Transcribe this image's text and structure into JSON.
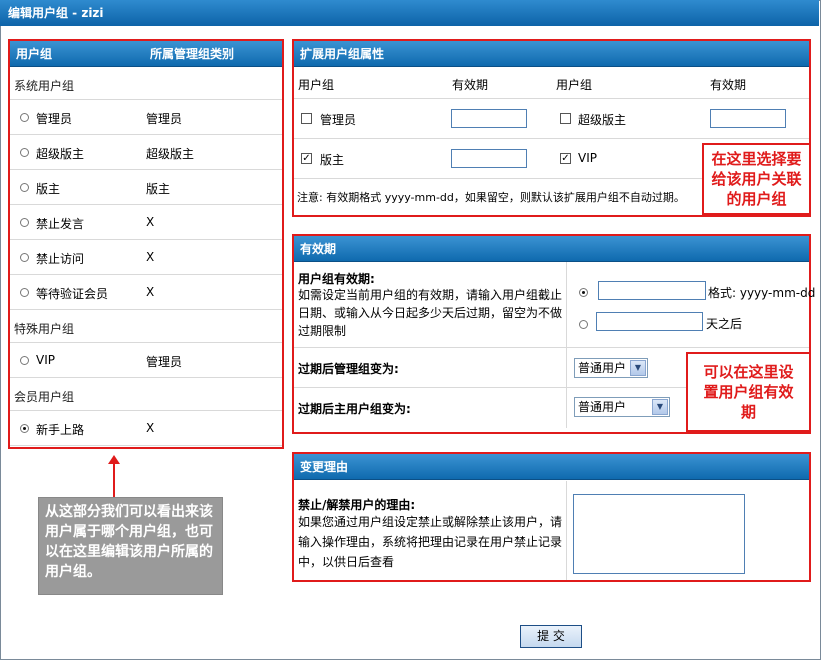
{
  "window": {
    "title": "编辑用户组 - zizi"
  },
  "left_panel": {
    "col_group": "用户组",
    "col_admin": "所属管理组类别",
    "sections": [
      {
        "title": "系统用户组",
        "items": [
          {
            "name": "管理员",
            "admin": "管理员",
            "selected": false
          },
          {
            "name": "超级版主",
            "admin": "超级版主",
            "selected": false
          },
          {
            "name": "版主",
            "admin": "版主",
            "selected": false
          },
          {
            "name": "禁止发言",
            "admin": "X",
            "selected": false
          },
          {
            "name": "禁止访问",
            "admin": "X",
            "selected": false
          },
          {
            "name": "等待验证会员",
            "admin": "X",
            "selected": false
          }
        ]
      },
      {
        "title": "特殊用户组",
        "items": [
          {
            "name": "VIP",
            "admin": "管理员",
            "selected": false
          }
        ]
      },
      {
        "title": "会员用户组",
        "items": [
          {
            "name": "新手上路",
            "admin": "X",
            "selected": true
          }
        ]
      }
    ]
  },
  "ext_panel": {
    "title": "扩展用户组属性",
    "col_group_1": "用户组",
    "col_valid_1": "有效期",
    "col_group_2": "用户组",
    "col_valid_2": "有效期",
    "rows": [
      {
        "left": {
          "name": "管理员",
          "checked": false
        },
        "right": {
          "name": "超级版主",
          "checked": false
        }
      },
      {
        "left": {
          "name": "版主",
          "checked": true
        },
        "right": {
          "name": "VIP",
          "checked": true
        }
      }
    ],
    "note": "注意: 有效期格式 yyyy-mm-dd，如果留空，则默认该扩展用户组不自动过期。"
  },
  "validity_panel": {
    "title": "有效期",
    "label_title": "用户组有效期:",
    "label_desc": "如需设定当前用户组的有效期，请输入用户组截止日期、或输入从今日起多少天后过期，留空为不做过期限制",
    "format_label": "格式: yyyy-mm-dd",
    "days_label": "天之后",
    "admin_after_label": "过期后管理组变为:",
    "admin_after_value": "普通用户",
    "main_after_label": "过期后主用户组变为:",
    "main_after_value": "普通用户"
  },
  "reason_panel": {
    "title": "变更理由",
    "label_title": "禁止/解禁用户的理由:",
    "label_desc": "如果您通过用户组设定禁止或解除禁止该用户，请输入操作理由，系统将把理由记录在用户禁止记录中，以供日后查看"
  },
  "annotations": {
    "ext_note": "在这里选择要给该用户关联的用户组",
    "validity_note": "可以在这里设置用户组有效期",
    "left_callout": "从这部分我们可以看出来该用户属于哪个用户组，也可以在这里编辑该用户所属的用户组。"
  },
  "submit_label": "提 交",
  "colors": {
    "accent_red": "#e01b1b",
    "header_blue": "#0f6aae",
    "callout_gray": "#9a9a9a"
  }
}
